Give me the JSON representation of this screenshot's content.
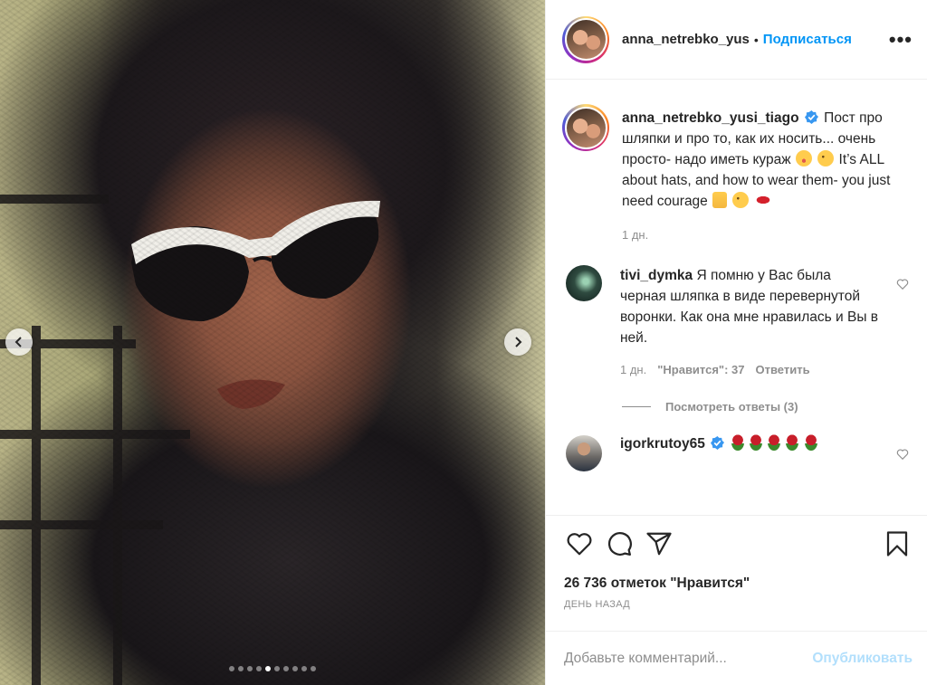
{
  "photo": {
    "description_icon": "portrait-photo",
    "carousel": {
      "total": 10,
      "active_index": 4
    }
  },
  "header": {
    "username": "anna_netrebko_yus",
    "separator": "•",
    "follow_label": "Подписаться",
    "more_icon": "more-icon"
  },
  "caption": {
    "username": "anna_netrebko_yusi_tiago",
    "verified": true,
    "text_part1": "Пост про шляпки и про то, как их носить... очень просто- надо иметь кураж",
    "text_part2": "It’s ALL about hats, and how to wear them- you just need courage",
    "time": "1 дн."
  },
  "comments": [
    {
      "username": "tivi_dymka",
      "text": "Я помню у Вас была черная шляпка в виде перевернутой воронки. Как она мне нравилась и Вы в ней.",
      "time": "1 дн.",
      "likes": "\"Нравится\": 37",
      "reply_label": "Ответить",
      "view_replies": "Посмотреть ответы (3)"
    },
    {
      "username": "igorkrutoy65",
      "verified": true,
      "emoji": "roses"
    }
  ],
  "actions": {
    "like_icon": "heart-icon",
    "comment_icon": "comment-icon",
    "share_icon": "share-icon",
    "save_icon": "bookmark-icon"
  },
  "likes_text": "26 736 отметок \"Нравится\"",
  "posted_ago": "День назад",
  "add_comment": {
    "placeholder": "Добавьте комментарий...",
    "publish_label": "Опубликовать"
  },
  "colors": {
    "link_blue": "#0095f6",
    "publish_disabled": "#b2dffc",
    "muted": "#8e8e8e",
    "text": "#262626"
  }
}
